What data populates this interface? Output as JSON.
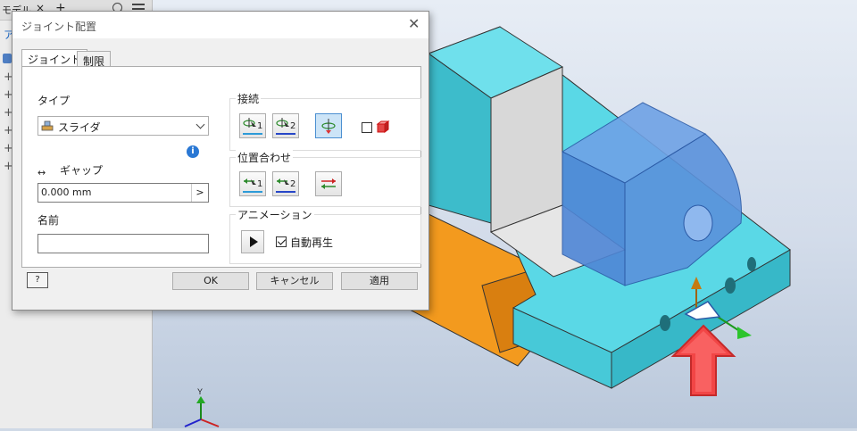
{
  "browser": {
    "tab_label": "モデル",
    "close_glyph": "×",
    "plus_glyph": "+",
    "filter_text": "ア",
    "tree_plus_glyph": "+"
  },
  "dialog": {
    "title": "ジョイント配置",
    "close_glyph": "✕",
    "tabs": [
      {
        "label": "ジョイント",
        "active": true
      },
      {
        "label": "制限",
        "active": false
      }
    ],
    "type_label": "タイプ",
    "type_value": "スライダ",
    "info_glyph": "i",
    "gap_label": "ギャップ",
    "gap_icon": "↔",
    "gap_value": "0.000 mm",
    "gap_arrow": ">",
    "name_label": "名前",
    "name_value": "",
    "connect": {
      "title": "接続",
      "button1_num": "1",
      "button2_num": "2",
      "checkbox_checked": false
    },
    "align": {
      "title": "位置合わせ",
      "button1_num": "1",
      "button2_num": "2"
    },
    "animation": {
      "title": "アニメーション",
      "autoplay_label": "自動再生",
      "autoplay_checked": true
    },
    "help_glyph": "?",
    "ok_label": "OK",
    "cancel_label": "キャンセル",
    "apply_label": "適用"
  },
  "viewport": {
    "triad": {
      "y_label": "Y"
    },
    "colors": {
      "part_cyan": "#5ad8e6",
      "part_orange": "#f39a1e",
      "selected_blue": "#4f86d6",
      "arrow_red": "#f24646"
    }
  }
}
